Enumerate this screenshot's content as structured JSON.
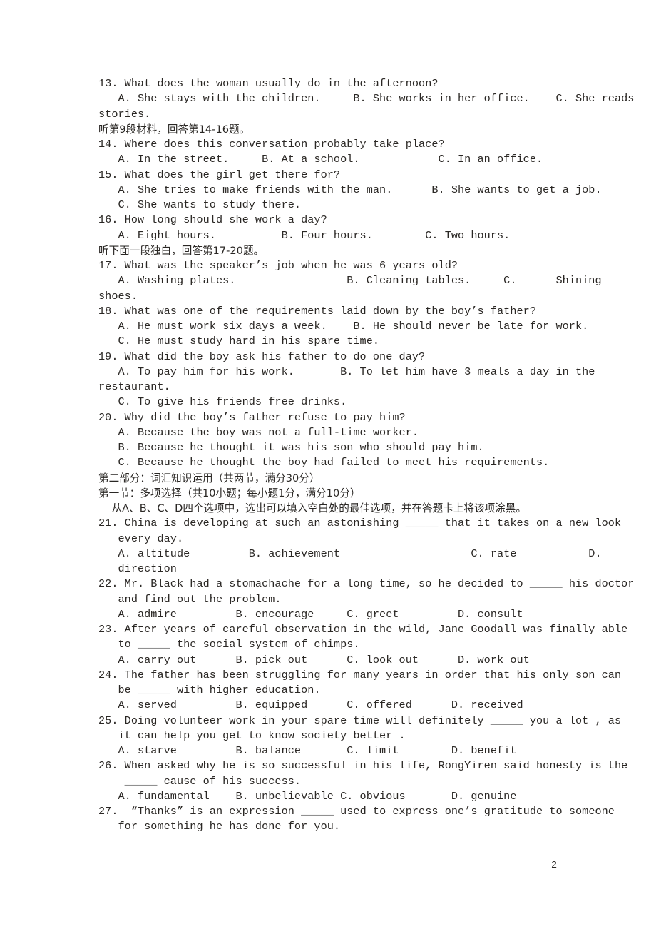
{
  "page": {
    "number": "2",
    "rule": true
  },
  "lines": [
    {
      "id": "q13-stem",
      "text": "13. What does the woman usually do in the afternoon?",
      "cjk": false
    },
    {
      "id": "q13-options-a",
      "text": "   A. She stays with the children.     B. She works in her office.    C. She reads",
      "cjk": false
    },
    {
      "id": "q13-options-b",
      "text": "stories.",
      "cjk": false
    },
    {
      "id": "listen-9",
      "text": "听第9段材料，回答第14-16题。",
      "cjk": true
    },
    {
      "id": "q14-stem",
      "text": "14. Where does this conversation probably take place?",
      "cjk": false
    },
    {
      "id": "q14-options",
      "text": "   A. In the street.     B. At a school.            C. In an office.",
      "cjk": false
    },
    {
      "id": "q15-stem",
      "text": "15. What does the girl get there for?",
      "cjk": false
    },
    {
      "id": "q15-options-a",
      "text": "   A. She tries to make friends with the man.      B. She wants to get a job.",
      "cjk": false
    },
    {
      "id": "q15-options-b",
      "text": "   C. She wants to study there.",
      "cjk": false
    },
    {
      "id": "q16-stem",
      "text": "16. How long should she work a day?",
      "cjk": false
    },
    {
      "id": "q16-options",
      "text": "   A. Eight hours.          B. Four hours.        C. Two hours.",
      "cjk": false
    },
    {
      "id": "listen-monologue",
      "text": "听下面一段独白，回答第17-20题。",
      "cjk": true
    },
    {
      "id": "q17-stem",
      "text": "17. What was the speaker’s job when he was 6 years old?",
      "cjk": false
    },
    {
      "id": "q17-options-a",
      "text": "   A. Washing plates.                 B. Cleaning tables.     C.      Shining",
      "cjk": false
    },
    {
      "id": "q17-options-b",
      "text": "shoes.",
      "cjk": false
    },
    {
      "id": "q18-stem",
      "text": "18. What was one of the requirements laid down by the boy’s father?",
      "cjk": false
    },
    {
      "id": "q18-options-a",
      "text": "   A. He must work six days a week.    B. He should never be late for work.",
      "cjk": false
    },
    {
      "id": "q18-options-b",
      "text": "   C. He must study hard in his spare time.",
      "cjk": false
    },
    {
      "id": "q19-stem",
      "text": "19. What did the boy ask his father to do one day?",
      "cjk": false
    },
    {
      "id": "q19-options-a",
      "text": "   A. To pay him for his work.       B. To let him have 3 meals a day in the",
      "cjk": false
    },
    {
      "id": "q19-options-b",
      "text": "restaurant.",
      "cjk": false
    },
    {
      "id": "q19-options-c",
      "text": "   C. To give his friends free drinks.",
      "cjk": false
    },
    {
      "id": "q20-stem",
      "text": "20. Why did the boy’s father refuse to pay him?",
      "cjk": false
    },
    {
      "id": "q20-option-a",
      "text": "   A. Because the boy was not a full-time worker.",
      "cjk": false
    },
    {
      "id": "q20-option-b",
      "text": "   B. Because he thought it was his son who should pay him.",
      "cjk": false
    },
    {
      "id": "q20-option-c",
      "text": "   C. Because he thought the boy had failed to meet his requirements.",
      "cjk": false
    },
    {
      "id": "part2-heading",
      "text": "第二部分：词汇知识运用（共两节，满分30分）",
      "cjk": true
    },
    {
      "id": "section1-heading",
      "text": "第一节：多项选择（共10小题；每小题1分，满分10分）",
      "cjk": true
    },
    {
      "id": "section1-direction",
      "text": "    从A、B、C、D四个选项中，选出可以填入空白处的最佳选项，并在答题卡上将该项涂黑。",
      "cjk": true
    },
    {
      "id": "q21-stem-a",
      "text": "21. China is developing at such an astonishing _____ that it takes on a new look",
      "cjk": false
    },
    {
      "id": "q21-stem-b",
      "text": "   every day.",
      "cjk": false
    },
    {
      "id": "q21-options-a",
      "text": "   A. altitude         B. achievement                    C. rate           D.",
      "cjk": false
    },
    {
      "id": "q21-options-b",
      "text": "   direction",
      "cjk": false
    },
    {
      "id": "q22-stem-a",
      "text": "22. Mr. Black had a stomachache for a long time, so he decided to _____ his doctor",
      "cjk": false
    },
    {
      "id": "q22-stem-b",
      "text": "   and find out the problem.",
      "cjk": false
    },
    {
      "id": "q22-options",
      "text": "   A. admire         B. encourage     C. greet         D. consult",
      "cjk": false
    },
    {
      "id": "q23-stem-a",
      "text": "23. After years of careful observation in the wild, Jane Goodall was finally able",
      "cjk": false
    },
    {
      "id": "q23-stem-b",
      "text": "   to _____ the social system of chimps.",
      "cjk": false
    },
    {
      "id": "q23-options",
      "text": "   A. carry out      B. pick out      C. look out      D. work out",
      "cjk": false
    },
    {
      "id": "q24-stem-a",
      "text": "24. The father has been struggling for many years in order that his only son can",
      "cjk": false
    },
    {
      "id": "q24-stem-b",
      "text": "   be _____ with higher education.",
      "cjk": false
    },
    {
      "id": "q24-options",
      "text": "   A. served         B. equipped      C. offered      D. received",
      "cjk": false
    },
    {
      "id": "q25-stem-a",
      "text": "25. Doing volunteer work in your spare time will definitely _____ you a lot , as",
      "cjk": false
    },
    {
      "id": "q25-stem-b",
      "text": "   it can help you get to know society better .",
      "cjk": false
    },
    {
      "id": "q25-options",
      "text": "   A. starve         B. balance       C. limit        D. benefit",
      "cjk": false
    },
    {
      "id": "q26-stem-a",
      "text": "26. When asked why he is so successful in his life, RongYiren said honesty is the",
      "cjk": false
    },
    {
      "id": "q26-stem-b",
      "text": "    _____ cause of his success.",
      "cjk": false
    },
    {
      "id": "q26-options",
      "text": "   A. fundamental    B. unbelievable C. obvious       D. genuine",
      "cjk": false
    },
    {
      "id": "q27-stem-a",
      "text": "27.  “Thanks” is an expression _____ used to express one’s gratitude to someone",
      "cjk": false
    },
    {
      "id": "q27-stem-b",
      "text": "   for something he has done for you.",
      "cjk": false
    }
  ]
}
